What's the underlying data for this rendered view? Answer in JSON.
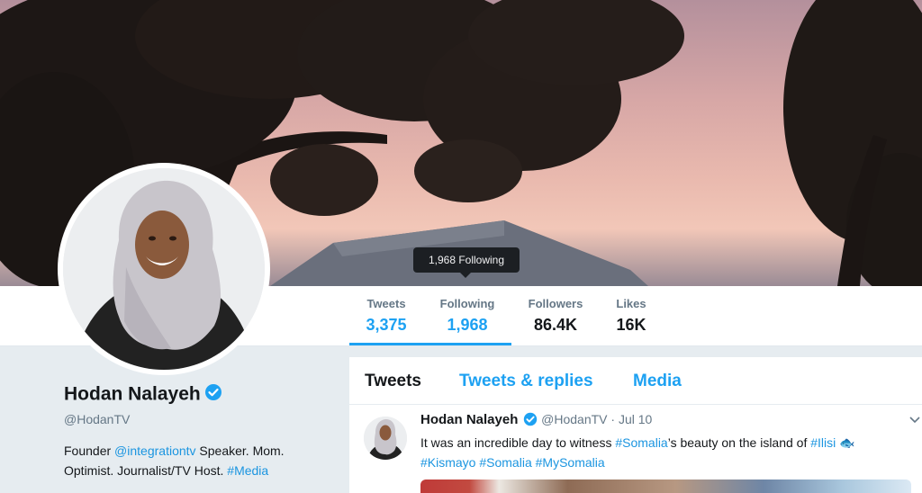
{
  "profile": {
    "name": "Hodan Nalayeh",
    "handle": "@HodanTV",
    "bio": {
      "prefix": "Founder ",
      "link1": "@integrationtv",
      "middle": " Speaker. Mom. Optimist. Journalist/TV Host. ",
      "link2": "#Media"
    }
  },
  "stats": [
    {
      "label": "Tweets",
      "value": "3,375"
    },
    {
      "label": "Following",
      "value": "1,968"
    },
    {
      "label": "Followers",
      "value": "86.4K"
    },
    {
      "label": "Likes",
      "value": "16K"
    }
  ],
  "tooltip": "1,968 Following",
  "tabs": [
    "Tweets",
    "Tweets & replies",
    "Media"
  ],
  "tweet": {
    "name": "Hodan Nalayeh",
    "handle": "@HodanTV",
    "sep": "·",
    "date": "Jul 10",
    "text_a": "It was an incredible day to witness ",
    "tag_somalia": "#Somalia",
    "text_b": "’s beauty on the island of ",
    "tag_ilisi": "#Ilisi",
    "emoji": "🐟",
    "tag_kismayo": "#Kismayo",
    "tag_somalia2": "#Somalia",
    "tag_mysomalia": "#MySomalia"
  },
  "colors": {
    "accent": "#1da1f2",
    "text": "#14171a",
    "muted": "#657786",
    "verified": "#1da1f2"
  },
  "icons": [
    "verified-badge-icon",
    "chevron-down-icon"
  ]
}
